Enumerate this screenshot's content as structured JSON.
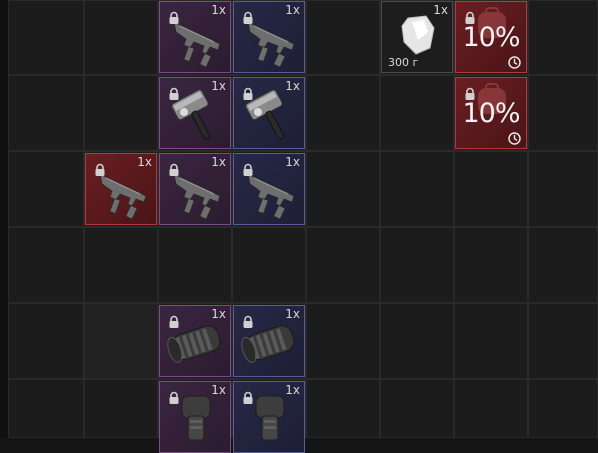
{
  "inventory": {
    "items": [
      {
        "id": "smg-1",
        "qty": "1x",
        "rarity": "purple",
        "kind": "smg",
        "locked": true
      },
      {
        "id": "smg-2",
        "qty": "1x",
        "rarity": "blue",
        "kind": "smg",
        "locked": true
      },
      {
        "id": "crystal",
        "qty": "1x",
        "rarity": "dark",
        "kind": "crystal",
        "locked": false,
        "weight": "300 г"
      },
      {
        "id": "boost-1",
        "qty": "",
        "rarity": "red",
        "kind": "boost",
        "locked": true,
        "percent": "10%",
        "timed": true
      },
      {
        "id": "hammer-1",
        "qty": "1x",
        "rarity": "purple",
        "kind": "hammer",
        "locked": true
      },
      {
        "id": "hammer-2",
        "qty": "1x",
        "rarity": "blue",
        "kind": "hammer",
        "locked": true
      },
      {
        "id": "boost-2",
        "qty": "",
        "rarity": "red",
        "kind": "boost",
        "locked": true,
        "percent": "10%",
        "timed": true
      },
      {
        "id": "smg-red",
        "qty": "1x",
        "rarity": "red",
        "kind": "smg",
        "locked": true
      },
      {
        "id": "smg-3",
        "qty": "1x",
        "rarity": "purple",
        "kind": "smg",
        "locked": true
      },
      {
        "id": "smg-4",
        "qty": "1x",
        "rarity": "blue",
        "kind": "smg",
        "locked": true
      },
      {
        "id": "part-1",
        "qty": "1x",
        "rarity": "purple",
        "kind": "part",
        "locked": true
      },
      {
        "id": "part-2",
        "qty": "1x",
        "rarity": "blue",
        "kind": "part",
        "locked": true
      },
      {
        "id": "mag-1",
        "qty": "1x",
        "rarity": "purple",
        "kind": "mag",
        "locked": true
      },
      {
        "id": "mag-2",
        "qty": "1x",
        "rarity": "blue",
        "kind": "mag",
        "locked": true
      }
    ]
  },
  "colors": {
    "purple": "#7a4c88",
    "blue": "#5a5c9a",
    "red": "#b23a3f"
  }
}
